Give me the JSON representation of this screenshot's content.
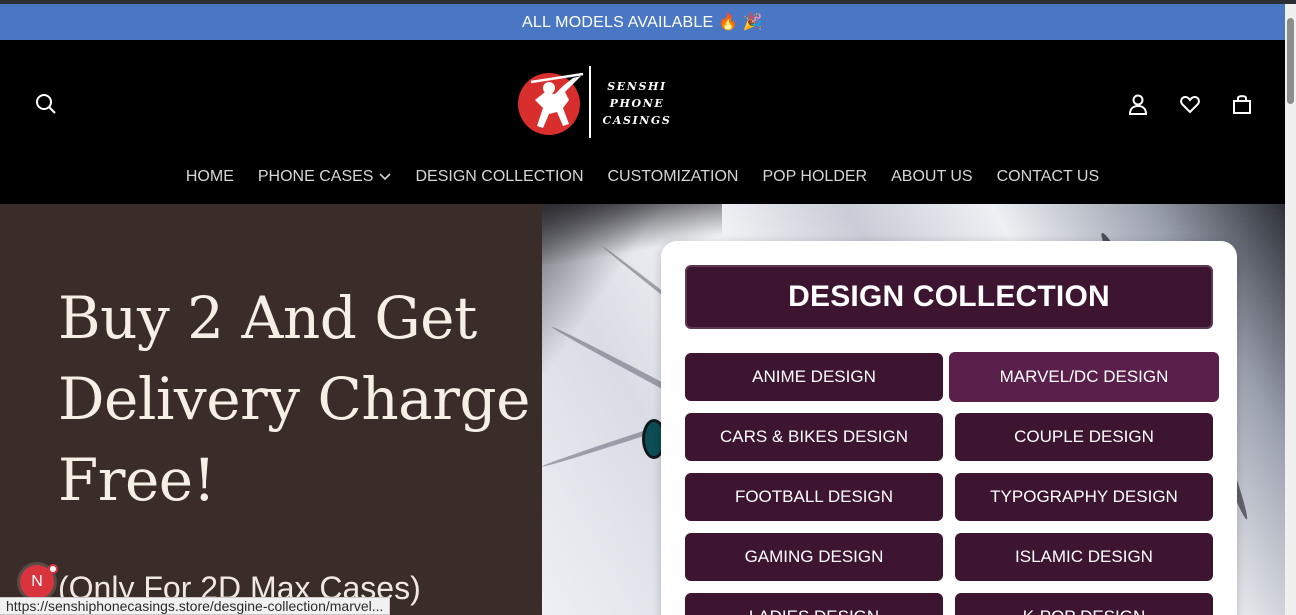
{
  "announcement": {
    "text": "ALL MODELS AVAILABLE 🔥 🎉"
  },
  "header": {
    "logo_text": [
      "SENSHI",
      "PHONE",
      "CASINGS"
    ],
    "icons": [
      "search-icon",
      "user-icon",
      "heart-icon",
      "bag-icon"
    ]
  },
  "nav": {
    "items": [
      {
        "label": "HOME"
      },
      {
        "label": "PHONE CASES"
      },
      {
        "label": "DESIGN COLLECTION"
      },
      {
        "label": "CUSTOMIZATION"
      },
      {
        "label": "POP HOLDER"
      },
      {
        "label": "ABOUT US"
      },
      {
        "label": "CONTACT US"
      }
    ]
  },
  "hero": {
    "title": "Buy 2 And Get Delivery Charge Free!",
    "subtitle": "(Only For 2D Max Cases)"
  },
  "collection": {
    "title": "DESIGN COLLECTION",
    "buttons": [
      {
        "label": "ANIME DESIGN"
      },
      {
        "label": "MARVEL/DC DESIGN"
      },
      {
        "label": "CARS & BIKES DESIGN"
      },
      {
        "label": "COUPLE DESIGN"
      },
      {
        "label": "FOOTBALL DESIGN"
      },
      {
        "label": "TYPOGRAPHY DESIGN"
      },
      {
        "label": "GAMING DESIGN"
      },
      {
        "label": "ISLAMIC DESIGN"
      },
      {
        "label": "LADIES DESIGN"
      },
      {
        "label": "K-POP DESIGN"
      }
    ]
  },
  "status_bar": {
    "url": "https://senshiphonecasings.store/desgine-collection/marvel..."
  },
  "avatar": {
    "initial": "N"
  },
  "colors": {
    "announcement_bg": "#4a77c4",
    "header_bg": "#000000",
    "button_bg": "#3d1530",
    "button_hover_bg": "#5a1f4a",
    "hero_left_bg": "#3a2c29"
  }
}
